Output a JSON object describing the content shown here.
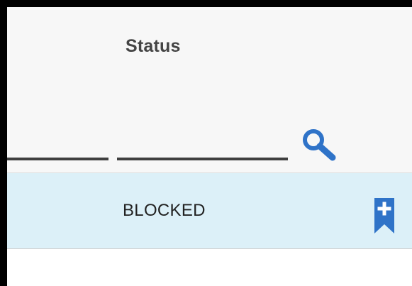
{
  "table": {
    "columns": [
      {
        "header": ""
      },
      {
        "header": "Status"
      }
    ],
    "rows": [
      {
        "status": "BLOCKED"
      }
    ]
  },
  "icons": {
    "search": "search-icon",
    "bookmark_add": "bookmark-add-icon"
  },
  "colors": {
    "accent": "#2f73c8",
    "row_highlight": "#dcf0f8",
    "header_background": "#f7f7f7"
  }
}
